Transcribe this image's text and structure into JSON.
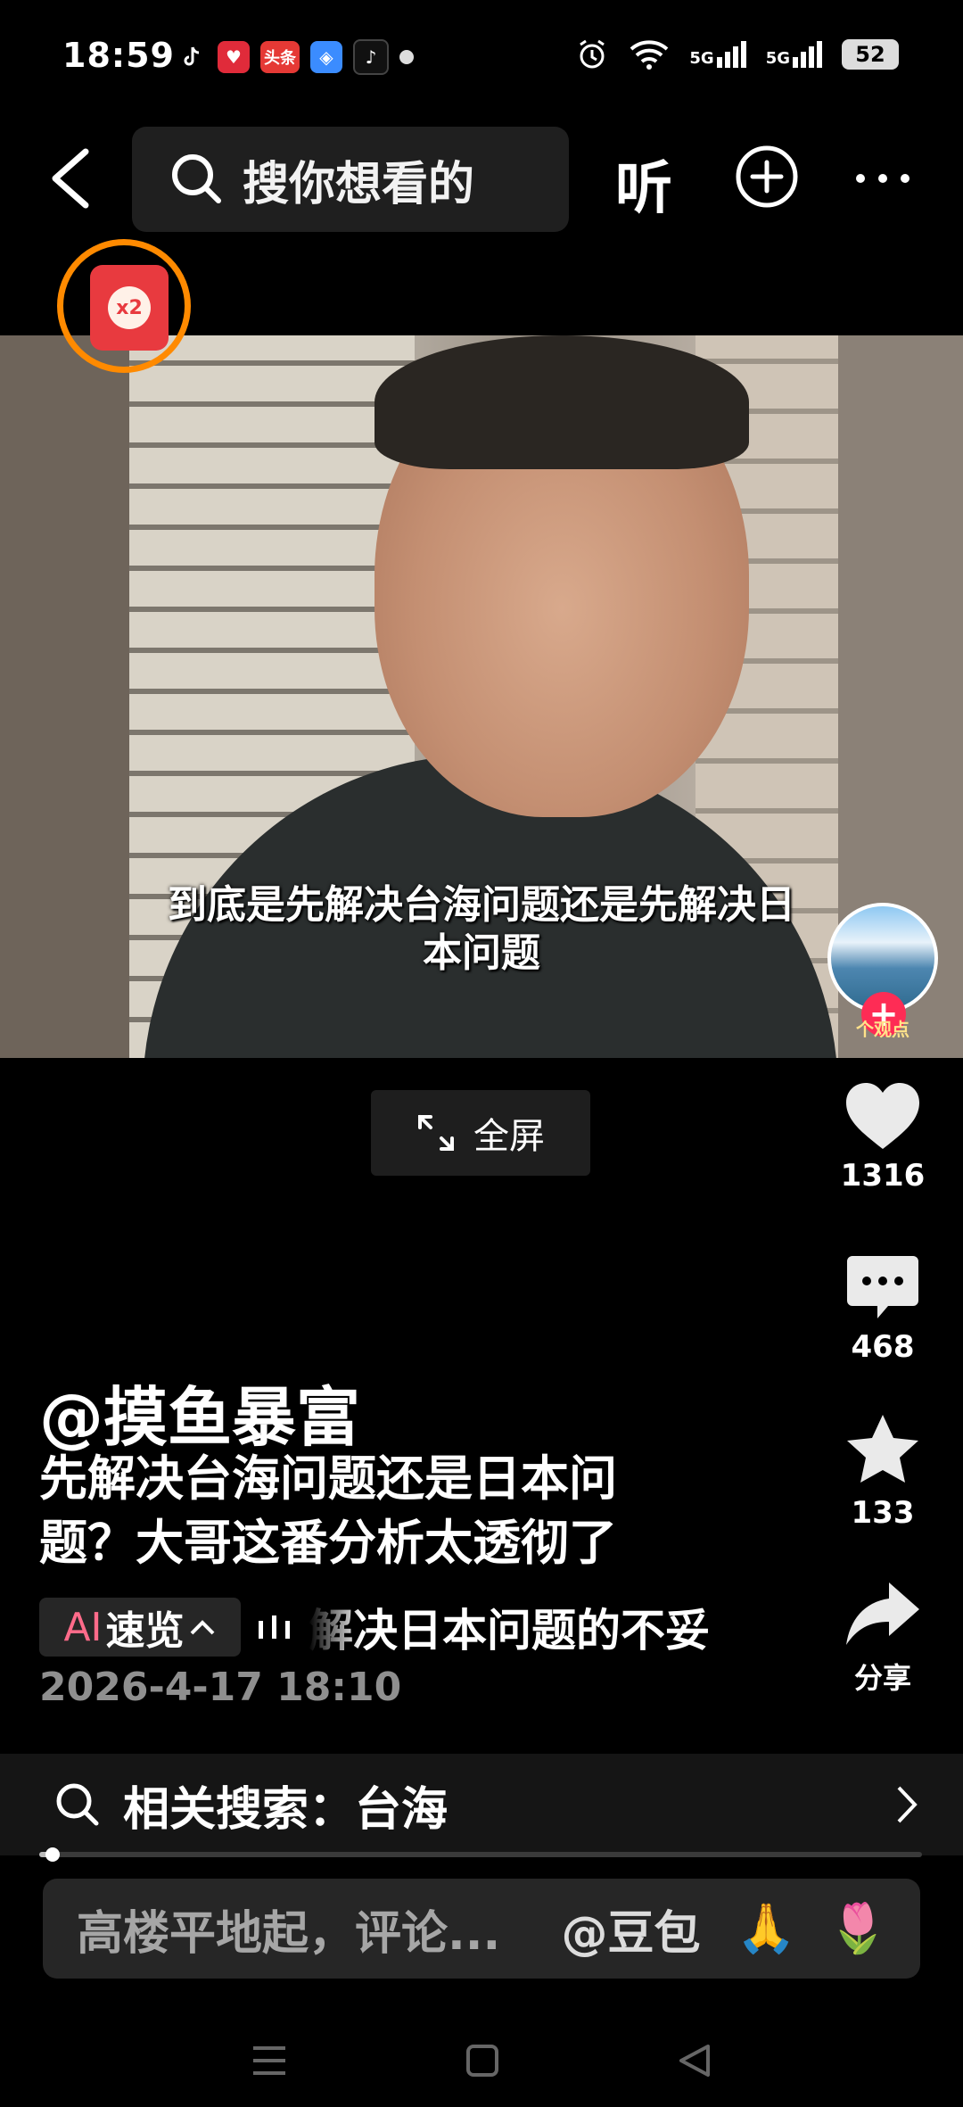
{
  "status_bar": {
    "time": "18:59",
    "app_badges": [
      "douyin-icon",
      "heart-app-icon",
      "toutiao-icon",
      "browser-icon",
      "douyin-lite-icon"
    ],
    "toutiao_label": "头条",
    "network": [
      "5G",
      "5G"
    ],
    "battery": "52"
  },
  "top_bar": {
    "search_placeholder": "搜你想看的",
    "listen_label": "听"
  },
  "red_packet": {
    "multiplier": "x2"
  },
  "video": {
    "subtitle_line1": "到底是先解决台海问题还是先解决日",
    "subtitle_line2": "本问题",
    "fullscreen_label": "全屏"
  },
  "creator": {
    "avatar_tag": "个观点",
    "handle": "@摸鱼暴富"
  },
  "actions": {
    "likes": "1316",
    "comments": "468",
    "favorites": "133",
    "share_label": "分享"
  },
  "post": {
    "title_line1": "先解决台海问题还是日本问",
    "title_line2": "题？大哥这番分析太透彻了",
    "ai_label": "AI",
    "ai_summary_label": "速览",
    "ai_summary_text": "解决日本问题的不妥",
    "date": "2026-4-17 18:10"
  },
  "related_search": {
    "label": "相关搜索：台海"
  },
  "progress": {
    "fraction": 0.015
  },
  "comment_bar": {
    "placeholder": "高楼平地起，评论...",
    "mention": "@豆包",
    "emoji1": "🙏",
    "emoji2": "🌷"
  },
  "colors": {
    "accent": "#fe2c55",
    "packet": "#e83a3f",
    "ring": "#ff8a00"
  }
}
